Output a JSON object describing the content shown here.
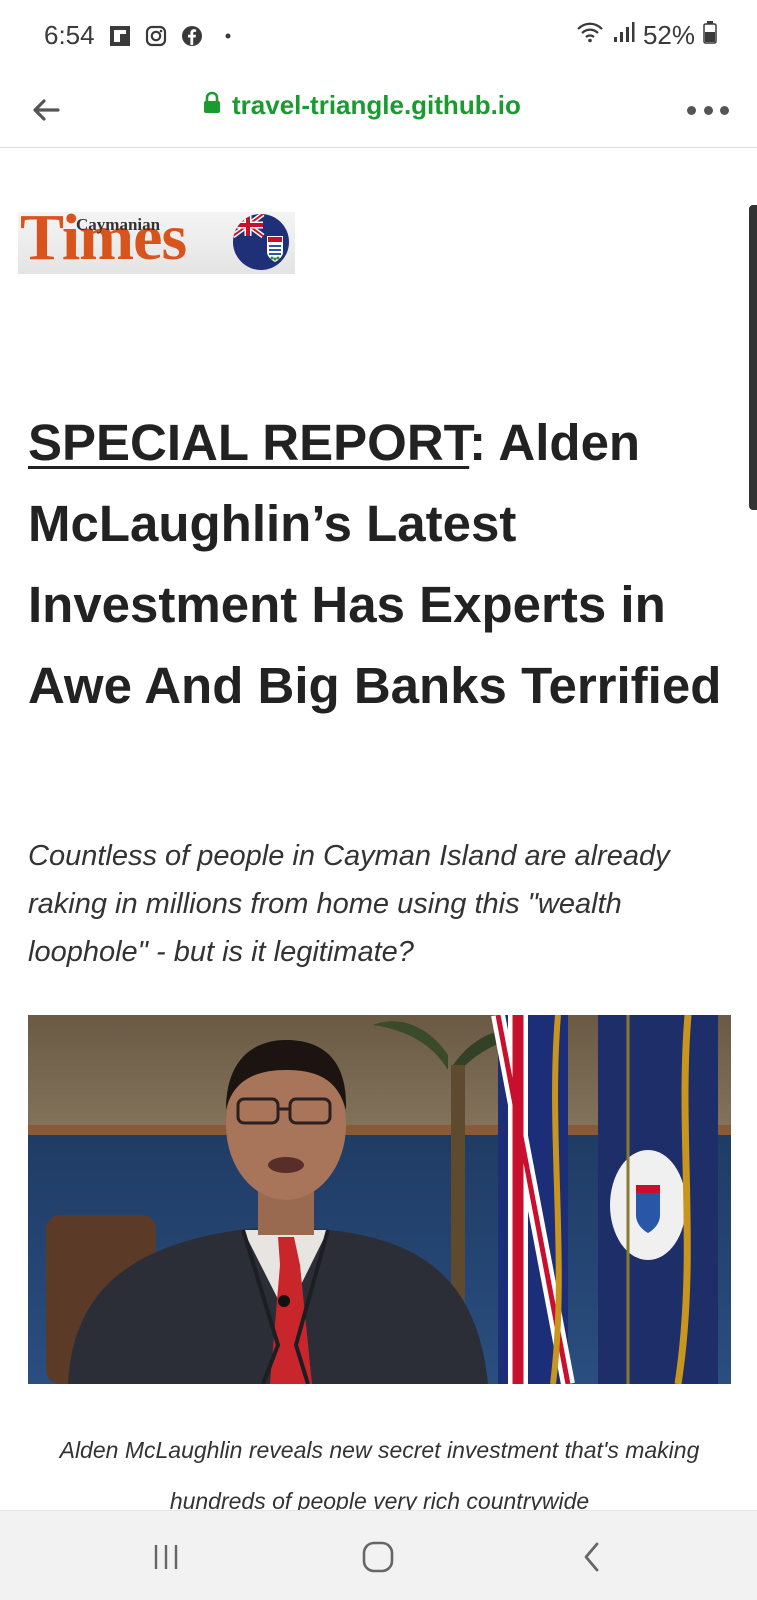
{
  "status_bar": {
    "time": "6:54",
    "battery": "52%",
    "icons": [
      "flipboard-icon",
      "instagram-icon",
      "facebook-icon",
      "notification-dot-icon",
      "wifi-icon",
      "signal-icon",
      "battery-icon"
    ]
  },
  "browser": {
    "url": "travel-triangle.github.io",
    "url_color": "#1a9b2f",
    "icons": [
      "back-arrow-icon",
      "lock-icon",
      "more-options-icon"
    ]
  },
  "logo": {
    "small_text": "Caymanian",
    "big_text": "Times"
  },
  "article": {
    "headline_label": "SPECIAL REPORT",
    "headline_rest": ": Alden McLaughlin’s Latest Investment Has Experts in Awe And Big Banks Terrified",
    "subhead": "Countless of people in Cayman Island are already raking in millions from home using this \"wealth loophole\" - but is it legitimate?",
    "caption": "Alden McLaughlin reveals new secret investment that's making hundreds of people very rich countrywide"
  },
  "nav_bar": {
    "icons": [
      "recent-apps-icon",
      "home-icon",
      "back-icon"
    ]
  },
  "colors": {
    "logo_orange": "#d9541c",
    "accent_green": "#1a9b2f",
    "text_dark": "#222222"
  }
}
